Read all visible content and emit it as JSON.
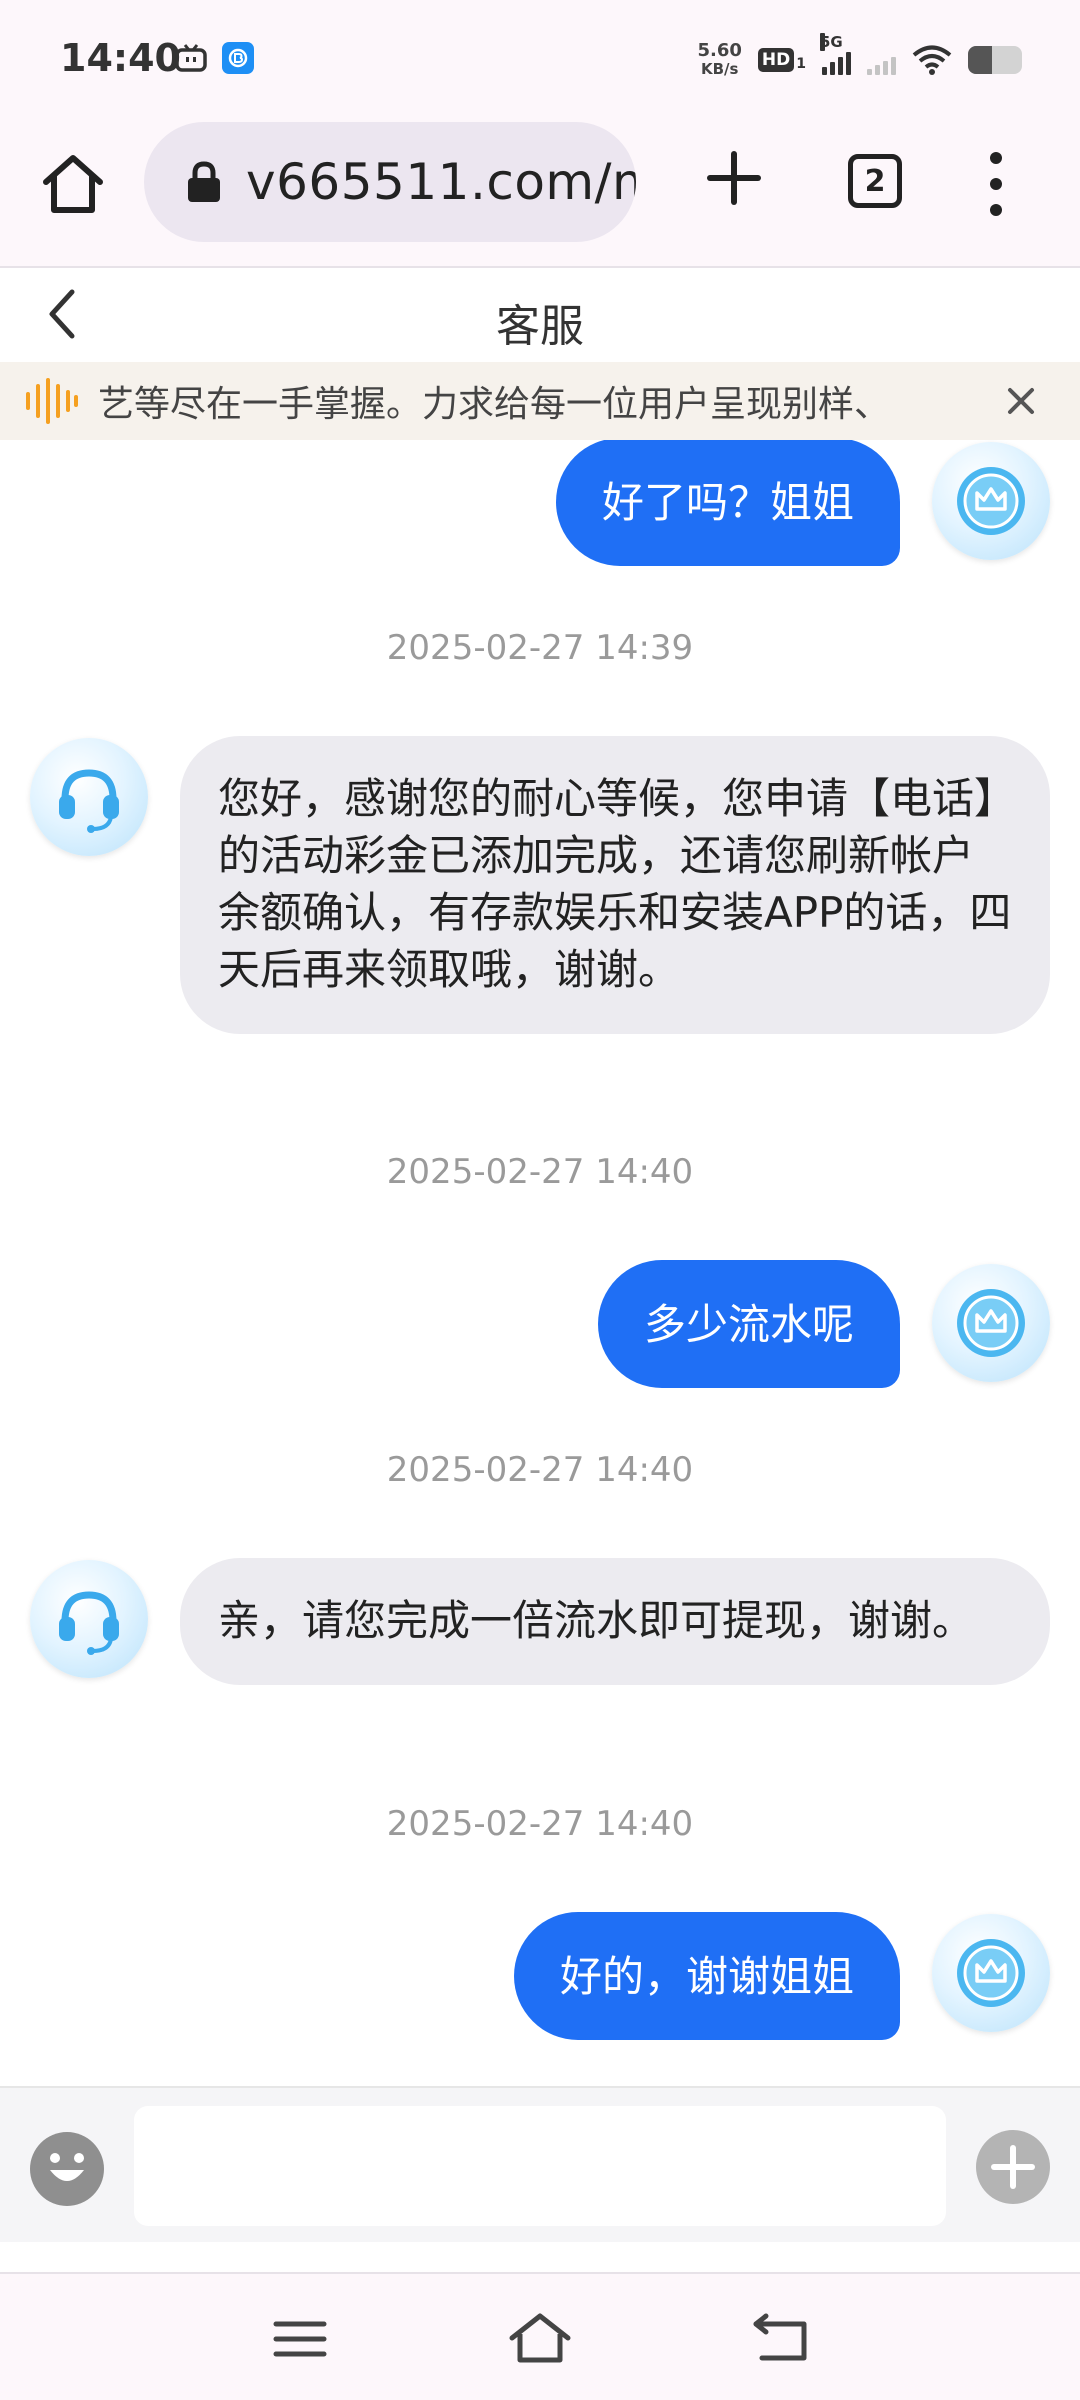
{
  "status_bar": {
    "time": "14:40",
    "net_speed_value": "5.60",
    "net_speed_unit": "KB/s",
    "hd_label": "HD",
    "hd_sub": "1",
    "signal_label": "5G",
    "battery_level": 0.45
  },
  "browser": {
    "url": "v665511.com/m",
    "tab_count": "2"
  },
  "header": {
    "title": "客服"
  },
  "marquee": {
    "text": "艺等尽在一手掌握。力求给每一位用户呈现别样、"
  },
  "chat": {
    "messages": [
      {
        "sender": "user",
        "text": "好了吗？姐姐"
      },
      {
        "timestamp": "2025-02-27 14:39"
      },
      {
        "sender": "agent",
        "text": "您好，感谢您的耐心等候，您申请【电话】的活动彩金已添加完成，还请您刷新帐户余额确认，有存款娱乐和安装APP的话，四天后再来领取哦，谢谢。"
      },
      {
        "timestamp": "2025-02-27 14:40"
      },
      {
        "sender": "user",
        "text": "多少流水呢"
      },
      {
        "timestamp": "2025-02-27 14:40"
      },
      {
        "sender": "agent",
        "text": "亲，请您完成一倍流水即可提现，谢谢。"
      },
      {
        "timestamp": "2025-02-27 14:40"
      },
      {
        "sender": "user",
        "text": "好的，谢谢姐姐"
      }
    ]
  },
  "input": {
    "value": "",
    "placeholder": ""
  },
  "icons": {
    "user_avatar": "crown-badge-icon",
    "agent_avatar": "headset-icon",
    "marquee": "sound-wave-icon"
  },
  "colors": {
    "user_bubble": "#1f6ff5",
    "agent_bubble": "#ecebf0",
    "marquee_icon": "#f5a020"
  }
}
